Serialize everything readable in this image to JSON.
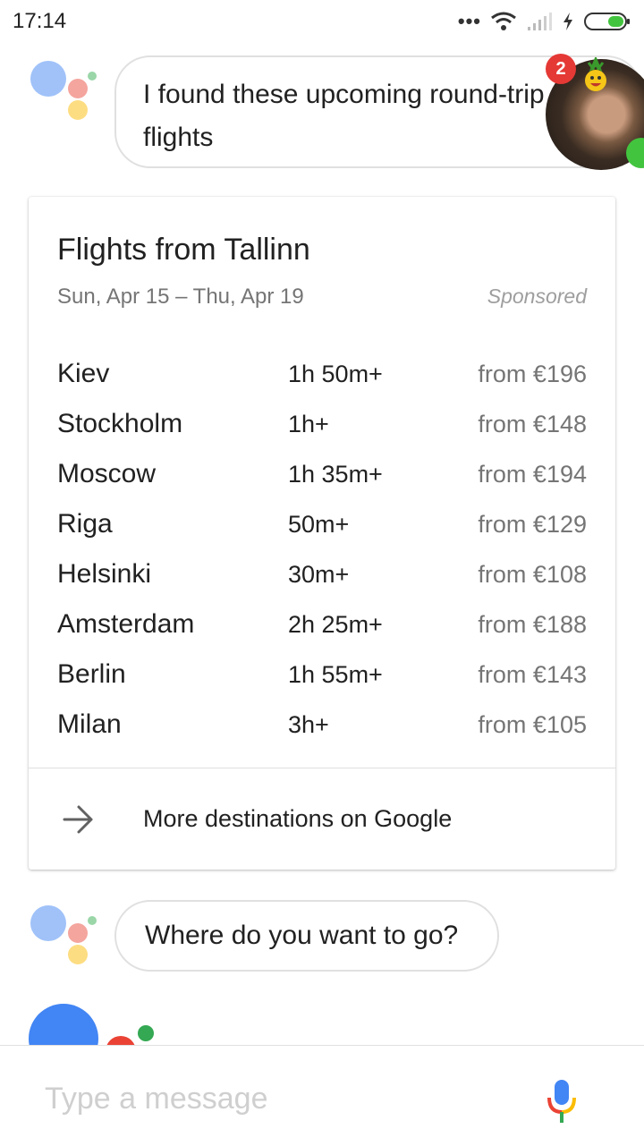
{
  "status_bar": {
    "time": "17:14",
    "icons": [
      "more-dots-icon",
      "wifi-icon",
      "signal-icon",
      "charging-icon",
      "battery-icon"
    ]
  },
  "messages": {
    "intro": "I found these upcoming round-trip flights",
    "question": "Where do you want to go?"
  },
  "chathead": {
    "badge_count": "2",
    "status_color": "#43c43f"
  },
  "flight_card": {
    "title": "Flights from Tallinn",
    "dates": "Sun, Apr 15 – Thu, Apr 19",
    "sponsored": "Sponsored",
    "flights": [
      {
        "city": "Kiev",
        "duration": "1h 50m+",
        "price": "from €196"
      },
      {
        "city": "Stockholm",
        "duration": "1h+",
        "price": "from €148"
      },
      {
        "city": "Moscow",
        "duration": "1h 35m+",
        "price": "from €194"
      },
      {
        "city": "Riga",
        "duration": "50m+",
        "price": "from €129"
      },
      {
        "city": "Helsinki",
        "duration": "30m+",
        "price": "from €108"
      },
      {
        "city": "Amsterdam",
        "duration": "2h 25m+",
        "price": "from €188"
      },
      {
        "city": "Berlin",
        "duration": "1h 55m+",
        "price": "from €143"
      },
      {
        "city": "Milan",
        "duration": "3h+",
        "price": "from €105"
      }
    ],
    "more_link": "More destinations on Google",
    "more_icon": "arrow-right-icon"
  },
  "input": {
    "placeholder": "Type a message",
    "mic_icon": "mic-icon"
  },
  "colors": {
    "google_blue": "#4285f4",
    "google_red": "#ea4335",
    "google_yellow": "#fbbc05",
    "google_green": "#34a853",
    "faded_blue": "#a0c2f9",
    "faded_red": "#f4a59e",
    "faded_yellow": "#fddd82",
    "faded_green": "#9ad6a8"
  }
}
